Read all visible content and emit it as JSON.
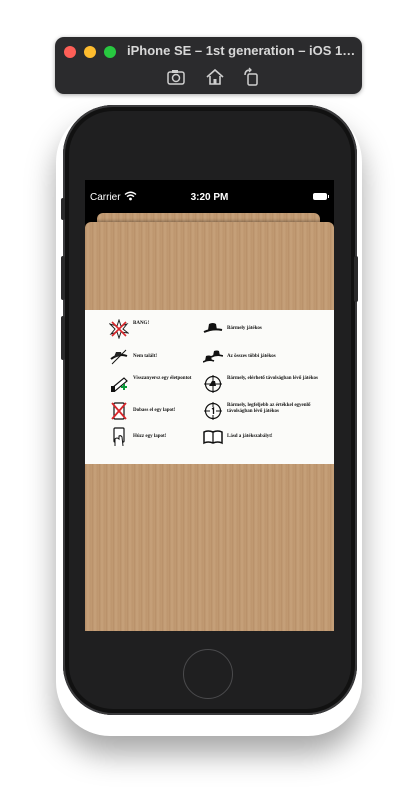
{
  "simulator": {
    "title": "iPhone SE – 1st generation – iOS 1…",
    "toolbar_icons": [
      "screenshot-icon",
      "home-icon",
      "rotate-icon"
    ]
  },
  "statusbar": {
    "carrier": "Carrier",
    "time": "3:20 PM"
  },
  "legend": {
    "left": [
      {
        "icon": "bang-icon",
        "text": "BANG!"
      },
      {
        "icon": "missed-icon",
        "text": "Nem talált!"
      },
      {
        "icon": "regain-life-icon",
        "text": "Visszanyersz egy életpontot"
      },
      {
        "icon": "discard-card-icon",
        "text": "Dobass el egy lapot!"
      },
      {
        "icon": "draw-card-icon",
        "text": "Húzz egy lapot!"
      }
    ],
    "right": [
      {
        "icon": "any-player-icon",
        "text": "Bármely játékos"
      },
      {
        "icon": "all-other-players-icon",
        "text": "Az összes többi játékos"
      },
      {
        "icon": "reachable-player-icon",
        "text": "Bármely, elérhető távolságban lévő játékos"
      },
      {
        "icon": "distance-one-icon",
        "text": "Bármely, legfeljebb az értékkel egyenlő távolságban lévő játékos"
      },
      {
        "icon": "rulebook-icon",
        "text": "Lásd a játékszabályt!"
      }
    ]
  },
  "colors": {
    "wood": "#c19a72",
    "titlebar": "#2b2b2d",
    "traffic_red": "#fe5f57",
    "traffic_yellow": "#febc2e",
    "traffic_green": "#28c840"
  }
}
